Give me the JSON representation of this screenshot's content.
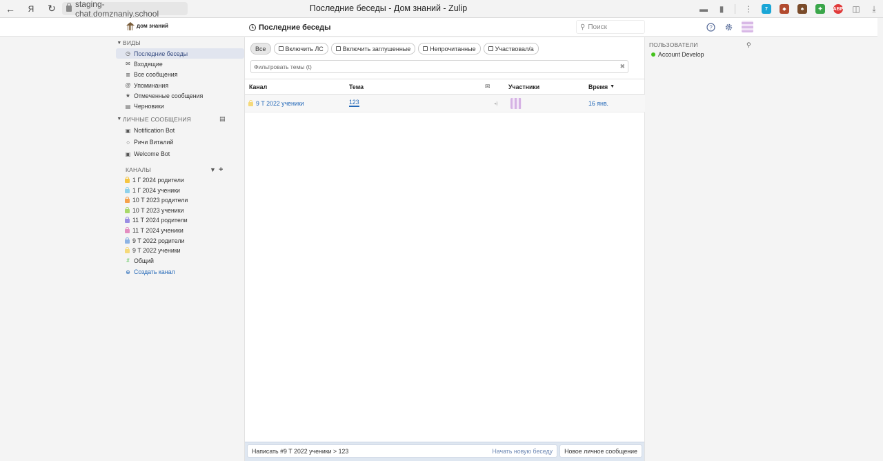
{
  "browser": {
    "url": "staging-chat.domznaniy.school",
    "window_title": "Последние беседы - Дом знаний - Zulip"
  },
  "header": {
    "logo_text": "дом знаний",
    "title": "Последние беседы",
    "search_placeholder": "Поиск"
  },
  "sidebar": {
    "views_label": "ВИДЫ",
    "views": [
      {
        "label": "Последние беседы",
        "icon": "clock-icon"
      },
      {
        "label": "Входящие",
        "icon": "inbox-icon"
      },
      {
        "label": "Все сообщения",
        "icon": "all-messages-icon"
      },
      {
        "label": "Упоминания",
        "icon": "at-icon"
      },
      {
        "label": "Отмеченные сообщения",
        "icon": "star-icon"
      },
      {
        "label": "Черновики",
        "icon": "drafts-icon"
      }
    ],
    "dm_label": "ЛИЧНЫЕ СООБЩЕНИЯ",
    "dms": [
      {
        "label": "Notification Bot",
        "icon": "bot-icon"
      },
      {
        "label": "Ричи Виталий",
        "icon": "circle-icon"
      },
      {
        "label": "Welcome Bot",
        "icon": "bot-icon"
      }
    ],
    "channels_label": "КАНАЛЫ",
    "channels": [
      {
        "label": "1 Г 2024 родители",
        "color": "#f5c542"
      },
      {
        "label": "1 Г 2024 ученики",
        "color": "#8fd1ea"
      },
      {
        "label": "10 Т 2023 родители",
        "color": "#f5a14a"
      },
      {
        "label": "10 Т 2023 ученики",
        "color": "#a8d86a"
      },
      {
        "label": "11 Т 2024 родители",
        "color": "#9a8de3"
      },
      {
        "label": "11 Т 2024 ученики",
        "color": "#e38dc0"
      },
      {
        "label": "9 Т 2022 родители",
        "color": "#8db3e3"
      },
      {
        "label": "9 Т 2022 ученики",
        "color": "#f5d97a"
      }
    ],
    "general": {
      "label": "Общий",
      "color": "#7ccf7a"
    },
    "create_channel": "Создать канал"
  },
  "filters": {
    "all": "Все",
    "include_dm": "Включить ЛС",
    "include_muted": "Включить заглушенные",
    "unread": "Непрочитанные",
    "participated": "Участвовал/а",
    "topic_placeholder": "Фильтровать темы (t)"
  },
  "table": {
    "columns": {
      "channel": "Канал",
      "topic": "Тема",
      "participants": "Участники",
      "time": "Время"
    },
    "rows": [
      {
        "channel": "9 Т 2022 ученики",
        "topic": "123",
        "time": "16 янв."
      }
    ]
  },
  "compose": {
    "message_to": "Написать #9 Т 2022 ученики > 123",
    "new_topic": "Начать новую беседу",
    "new_dm": "Новое личное сообщение"
  },
  "right_sidebar": {
    "users_label": "ПОЛЬЗОВАТЕЛИ",
    "users": [
      {
        "name": "Account Develop",
        "status": "active"
      }
    ]
  }
}
